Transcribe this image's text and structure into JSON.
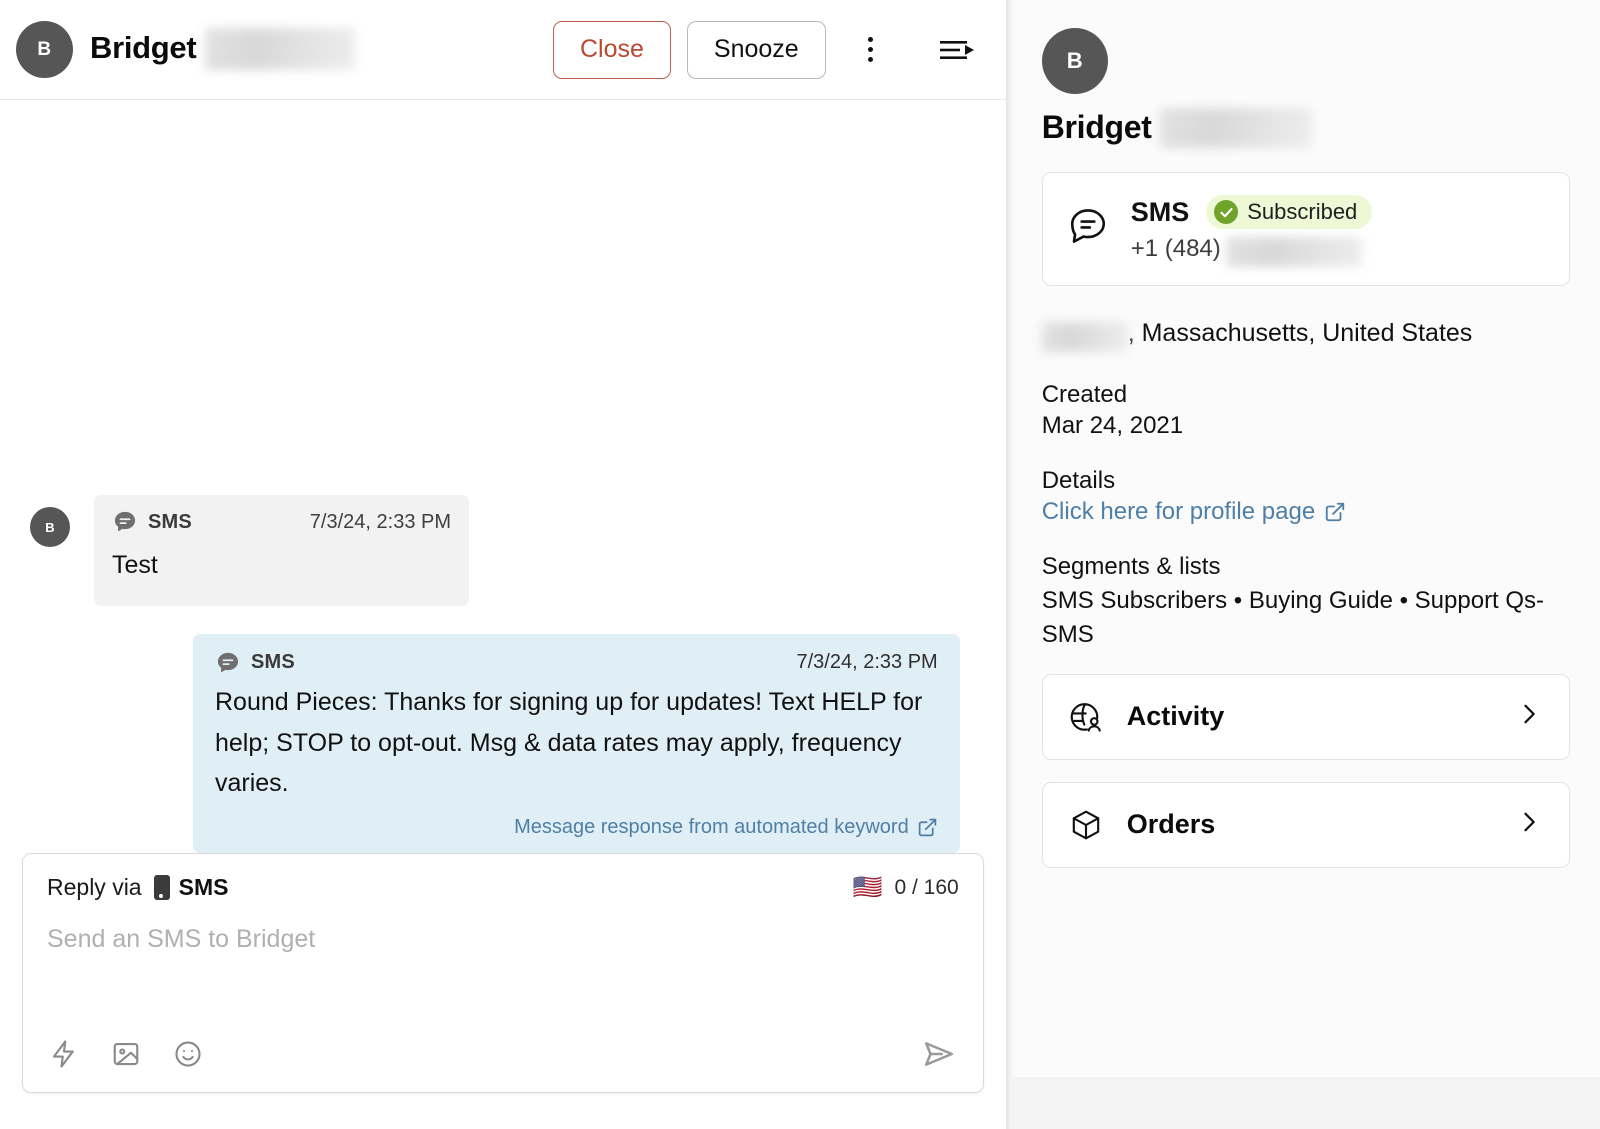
{
  "header": {
    "avatar_initial": "B",
    "contact_name": "Bridget",
    "close_label": "Close",
    "snooze_label": "Snooze",
    "kebab_icon": "more-vertical-icon",
    "list_icon": "collapse-list-icon"
  },
  "thread": {
    "messages": [
      {
        "direction": "incoming",
        "avatar_initial": "B",
        "channel": "SMS",
        "timestamp": "7/3/24, 2:33 PM",
        "body": "Test",
        "footnote": ""
      },
      {
        "direction": "outgoing",
        "channel": "SMS",
        "timestamp": "7/3/24, 2:33 PM",
        "body": "Round Pieces: Thanks for signing up for updates! Text HELP for help; STOP to opt-out. Msg & data rates may apply, frequency varies.",
        "footnote": "Message response from automated keyword"
      }
    ]
  },
  "composer": {
    "reply_via_label": "Reply via",
    "channel": "SMS",
    "country_flag": "🇺🇸",
    "char_count": "0 / 160",
    "placeholder": "Send an SMS to Bridget",
    "tools": [
      "lightning-icon",
      "image-icon",
      "emoji-icon"
    ],
    "send_icon": "send-icon"
  },
  "sidebar": {
    "avatar_initial": "B",
    "contact_name": "Bridget",
    "sms_card": {
      "title": "SMS",
      "status": "Subscribed",
      "phone": "+1 (484)"
    },
    "address": ", Massachusetts, United States",
    "created_label": "Created",
    "created_value": "Mar 24, 2021",
    "details_label": "Details",
    "details_link": "Click here for profile page",
    "segments_label": "Segments & lists",
    "segments_value": "SMS Subscribers • Buying Guide • Support Qs- SMS",
    "nav_items": [
      {
        "label": "Activity",
        "icon": "activity-globe-person-icon"
      },
      {
        "label": "Orders",
        "icon": "package-box-icon"
      }
    ]
  },
  "colors": {
    "accent_close": "#b9492f",
    "bubble_outgoing": "#e0eff6",
    "bubble_incoming": "#f2f2f2",
    "badge_bg": "#eef8d6",
    "badge_check": "#6fa32a",
    "link": "#4e7fa8"
  }
}
